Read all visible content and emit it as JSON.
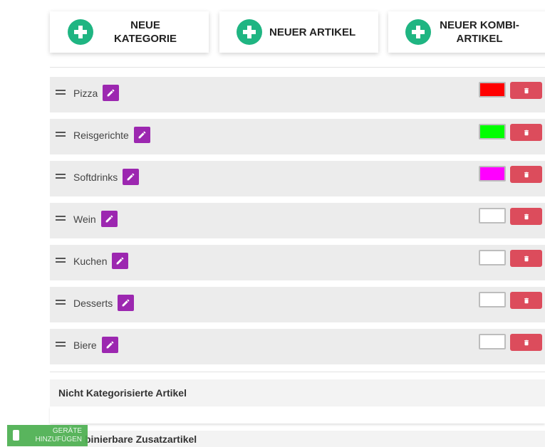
{
  "toolbar": {
    "new_category_line1": "NEUE",
    "new_category_line2": "KATEGORIE",
    "new_article": "NEUER ARTIKEL",
    "new_combo_line1": "NEUER KOMBI-",
    "new_combo_line2": "ARTIKEL"
  },
  "categories": [
    {
      "name": "Pizza",
      "color": "#ff0000"
    },
    {
      "name": "Reisgerichte",
      "color": "#00ff00"
    },
    {
      "name": "Softdrinks",
      "color": "#ff00ff"
    },
    {
      "name": "Wein",
      "color": "#ffffff"
    },
    {
      "name": "Kuchen",
      "color": "#ffffff"
    },
    {
      "name": "Desserts",
      "color": "#ffffff"
    },
    {
      "name": "Biere",
      "color": "#ffffff"
    }
  ],
  "sections": {
    "uncategorized": "Nicht Kategorisierte Artikel",
    "combinable_partial": "binierbare Zusatzartikel"
  },
  "device_button": {
    "line1": "GERÄTE",
    "line2": "HINZUFÜGEN"
  },
  "colors": {
    "accent_green": "#1fb582",
    "edit_purple": "#9c27b0",
    "delete_red": "#dc4c5c"
  },
  "icons": {
    "add": "plus-circle-icon",
    "drag": "drag-handle-icon",
    "edit": "pencil-icon",
    "delete": "trash-icon",
    "device": "phone-icon"
  }
}
